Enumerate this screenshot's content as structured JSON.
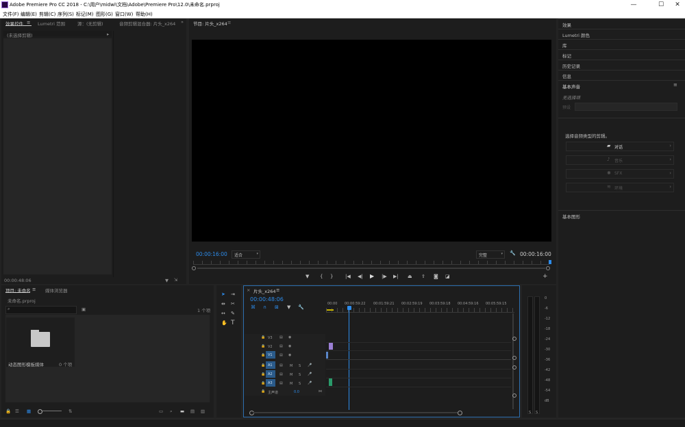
{
  "window": {
    "title": "Adobe Premiere Pro CC 2018 - C:\\用户\\midwi\\文档\\Adobe\\Premiere Pro\\12.0\\未命名.prproj",
    "minimize": "—",
    "maximize": "☐",
    "close": "✕"
  },
  "menu": [
    "文件(F)",
    "编辑(E)",
    "剪辑(C)",
    "序列(S)",
    "标记(M)",
    "图形(G)",
    "窗口(W)",
    "帮助(H)"
  ],
  "source_panel": {
    "tabs": [
      "效果控件",
      "Lumetri 范围",
      "源：(无剪辑)",
      "音频剪辑混合器: 片头_x264"
    ],
    "menu_glyph": "≡",
    "more_glyph": "»",
    "no_clip": "(未选择剪辑)",
    "timecode": "00:00:48:06"
  },
  "program_monitor": {
    "title": "节目: 片头_x264",
    "menu_glyph": "≡",
    "timecode_left": "00:00:16:00",
    "fit_option": "适合",
    "quality_option": "完整",
    "timecode_right": "00:00:16:00"
  },
  "project_panel": {
    "tabs": [
      "项目: 未命名",
      "媒体浏览器"
    ],
    "menu_glyph": "≡",
    "project_file": "未命名.prproj",
    "item_count": "1 个项",
    "bin_name": "动态图形模板媒体",
    "bin_count": "0 个项"
  },
  "timeline": {
    "sequence_tab": "片头_x264",
    "close_glyph": "×",
    "menu_glyph": "≡",
    "timecode": "00:00:48:06",
    "ruler": [
      "00:00",
      "00:00:59:22",
      "00:01:59:21",
      "00:02:59:19",
      "00:03:59:18",
      "00:04:59:16",
      "00:05:59:15"
    ],
    "video_tracks": [
      "V3",
      "V2",
      "V1"
    ],
    "audio_tracks": [
      "A1",
      "A2",
      "A3"
    ],
    "master": "主声道",
    "master_value": "0.0",
    "mute": "M",
    "solo": "S"
  },
  "meter_scale": [
    "0",
    "-6",
    "-12",
    "-18",
    "-24",
    "-30",
    "-36",
    "-42",
    "-48",
    "-54",
    "dB"
  ],
  "meter_solo": [
    "S",
    "S"
  ],
  "right_panel": {
    "items": [
      "效果",
      "Lumetri 颜色",
      "库",
      "标记",
      "历史记录",
      "信息"
    ],
    "essential_sound": "基本声音",
    "menu_glyph": "≡",
    "no_selection": "无选择项",
    "preset_label": "预设",
    "choose_type": "选择音频类型的剪辑。",
    "types": [
      "对话",
      "音乐",
      "SFX",
      "环境"
    ],
    "chevron": "›",
    "essential_graphics": "基本图形"
  },
  "colors": {
    "accent": "#2d8ceb",
    "clip_video": "#9b7fd4",
    "clip_audio": "#2a9a6a",
    "panel": "#1d1d1d",
    "background": "#232323"
  }
}
